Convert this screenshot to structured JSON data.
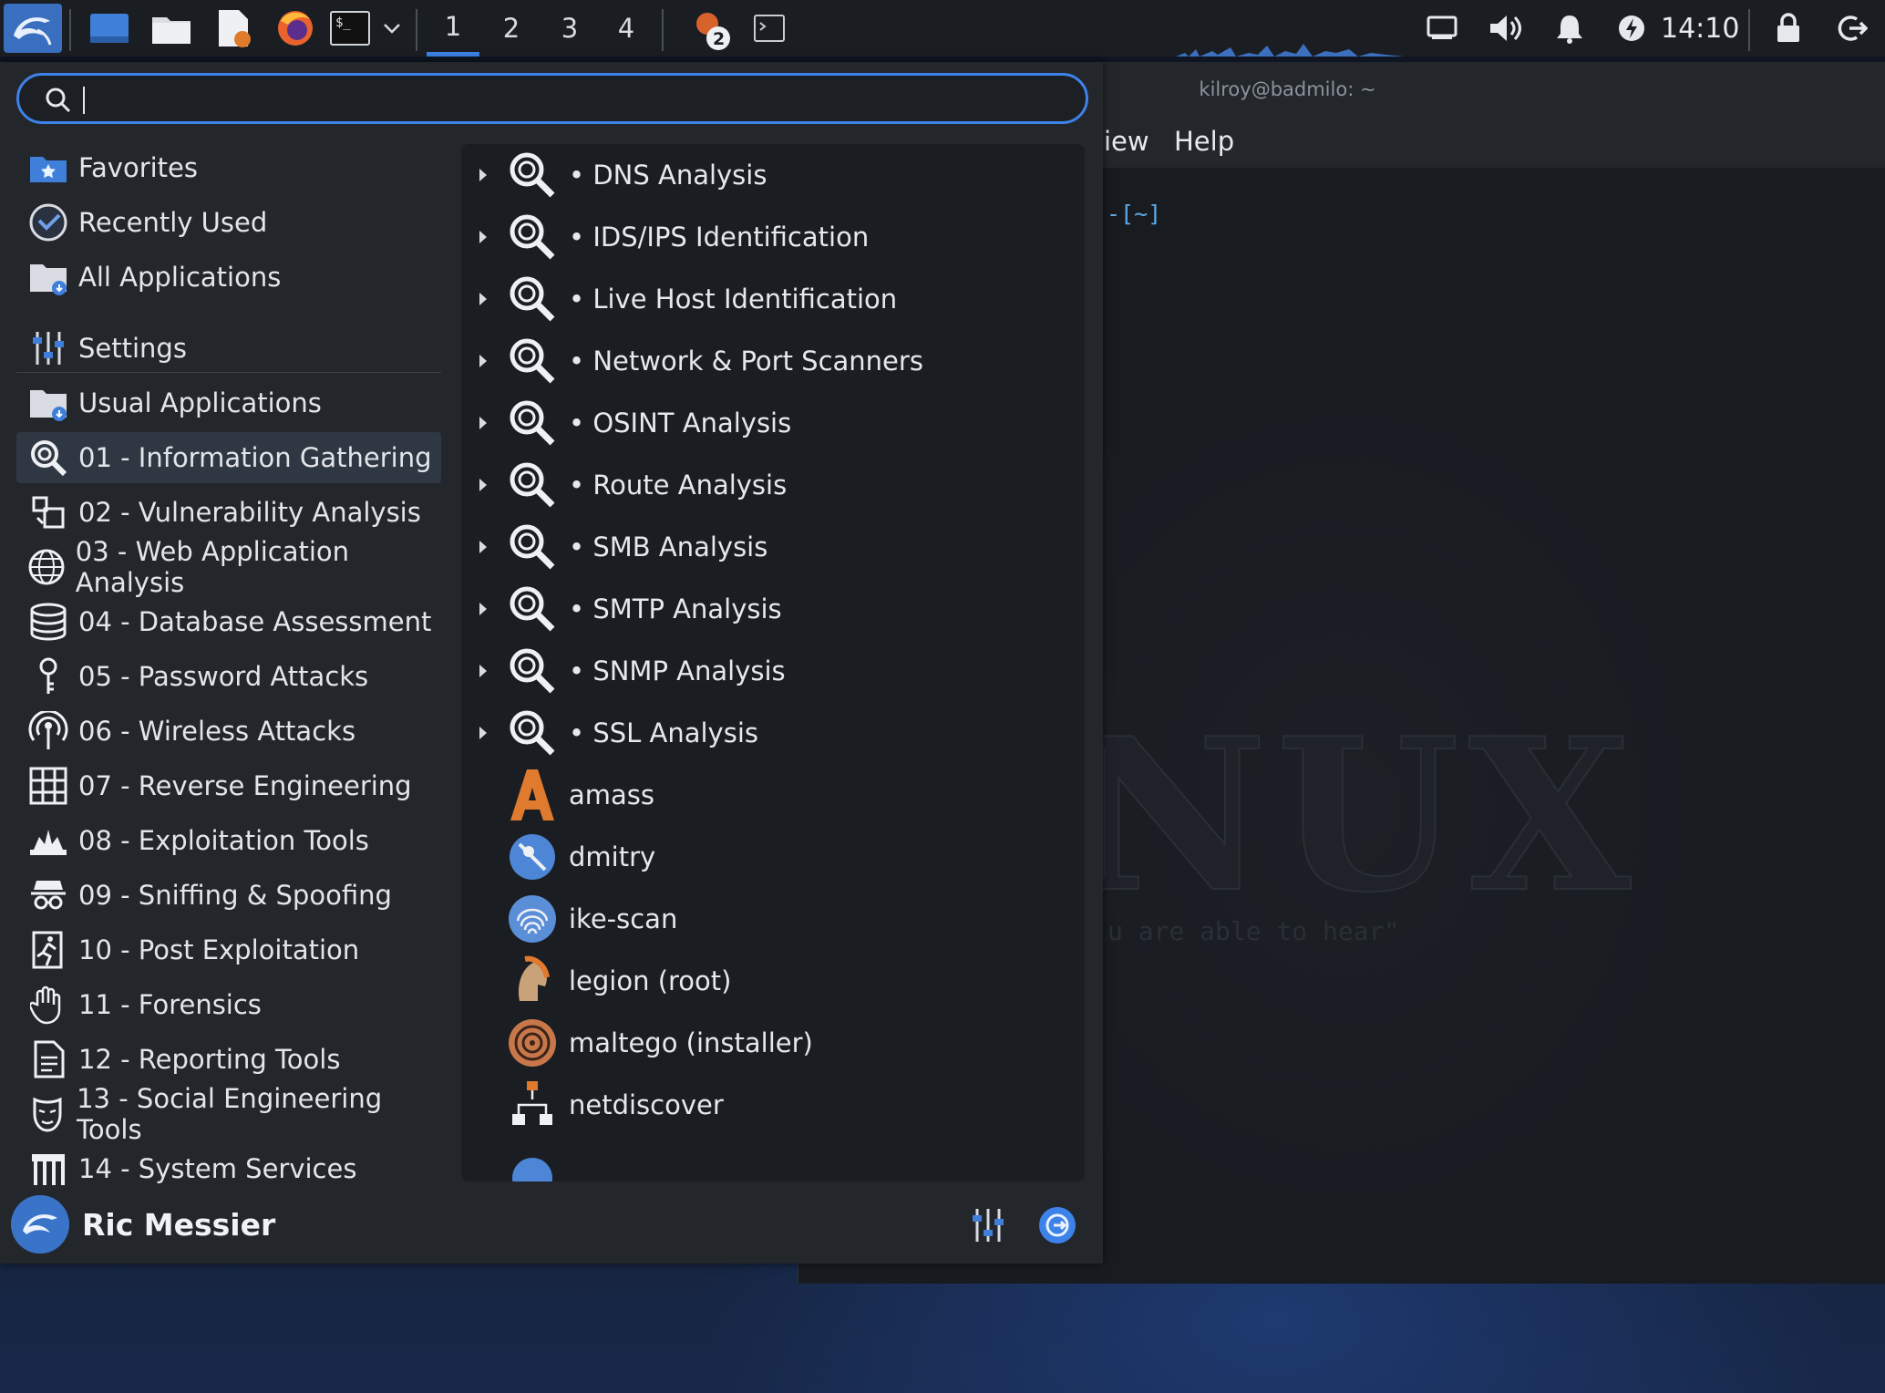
{
  "panel": {
    "workspaces": [
      "1",
      "2",
      "3",
      "4"
    ],
    "active_workspace": "1",
    "notification_count": "2",
    "clock": "14:10"
  },
  "terminal": {
    "title": "kilroy@badmilo: ~",
    "menu_view": "iew",
    "menu_help": "Help",
    "prompt": "-[~]",
    "watermark": "NUX",
    "quote": "u are able to hear\""
  },
  "menu": {
    "search_value": "",
    "categories": [
      {
        "label": "Favorites",
        "icon": "favorites-folder-icon"
      },
      {
        "label": "Recently Used",
        "icon": "recent-clock-icon"
      },
      {
        "label": "All Applications",
        "icon": "all-apps-folder-icon"
      },
      {
        "label": "Settings",
        "icon": "settings-sliders-icon"
      },
      {
        "label": "Usual Applications",
        "icon": "usual-apps-folder-icon"
      },
      {
        "label": "01 - Information Gathering",
        "icon": "magnifier-icon"
      },
      {
        "label": "02 - Vulnerability Analysis",
        "icon": "vulnerability-icon"
      },
      {
        "label": "03 - Web Application Analysis",
        "icon": "globe-icon"
      },
      {
        "label": "04 - Database Assessment",
        "icon": "database-icon"
      },
      {
        "label": "05 - Password Attacks",
        "icon": "key-icon"
      },
      {
        "label": "06 - Wireless Attacks",
        "icon": "wireless-icon"
      },
      {
        "label": "07 - Reverse Engineering",
        "icon": "grid-icon"
      },
      {
        "label": "08 - Exploitation Tools",
        "icon": "exploit-icon"
      },
      {
        "label": "09 - Sniffing & Spoofing",
        "icon": "spy-mask-icon"
      },
      {
        "label": "10 - Post Exploitation",
        "icon": "running-man-icon"
      },
      {
        "label": "11 - Forensics",
        "icon": "hand-icon"
      },
      {
        "label": "12 - Reporting Tools",
        "icon": "document-icon"
      },
      {
        "label": "13 - Social Engineering Tools",
        "icon": "mask-icon"
      },
      {
        "label": "14 - System Services",
        "icon": "services-icon"
      }
    ],
    "active_category": "01 - Information Gathering",
    "apps": [
      {
        "label": "• DNS Analysis",
        "submenu": true
      },
      {
        "label": "• IDS/IPS Identification",
        "submenu": true
      },
      {
        "label": "• Live Host Identification",
        "submenu": true
      },
      {
        "label": "• Network & Port Scanners",
        "submenu": true
      },
      {
        "label": "• OSINT Analysis",
        "submenu": true
      },
      {
        "label": "• Route Analysis",
        "submenu": true
      },
      {
        "label": "• SMB Analysis",
        "submenu": true
      },
      {
        "label": "• SMTP Analysis",
        "submenu": true
      },
      {
        "label": "• SNMP Analysis",
        "submenu": true
      },
      {
        "label": "• SSL Analysis",
        "submenu": true
      },
      {
        "label": "amass",
        "submenu": false
      },
      {
        "label": "dmitry",
        "submenu": false
      },
      {
        "label": "ike-scan",
        "submenu": false
      },
      {
        "label": "legion (root)",
        "submenu": false
      },
      {
        "label": "maltego (installer)",
        "submenu": false
      },
      {
        "label": "netdiscover",
        "submenu": false
      }
    ],
    "user_name": "Ric Messier"
  },
  "colors": {
    "accent": "#3d82e8",
    "panel_bg": "#1a1e23",
    "menu_bg": "#23272c",
    "apps_bg": "#1a1d21",
    "active_category_bg": "#2f3742"
  }
}
